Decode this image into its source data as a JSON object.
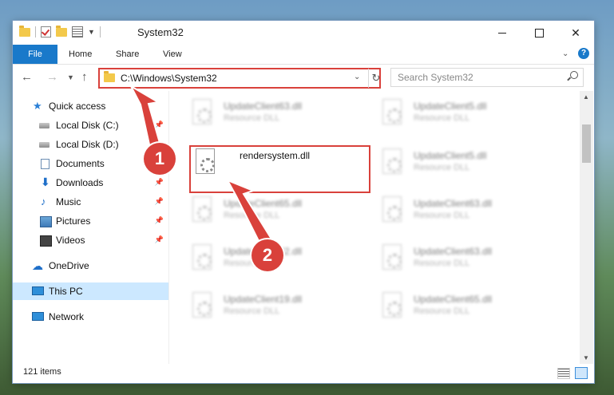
{
  "window": {
    "title": "System32",
    "controls": {
      "minimize": "",
      "maximize": "",
      "close": "✕"
    }
  },
  "ribbon": {
    "tabs": [
      {
        "label": "File"
      },
      {
        "label": "Home"
      },
      {
        "label": "Share"
      },
      {
        "label": "View"
      }
    ],
    "help": "?"
  },
  "navigation": {
    "address": "C:\\Windows\\System32",
    "search_placeholder": "Search System32"
  },
  "sidebar": {
    "items": [
      {
        "label": "Quick access",
        "icon": "star-icon",
        "pinned": false
      },
      {
        "label": "Local Disk (C:)",
        "icon": "disk-icon",
        "pinned": true
      },
      {
        "label": "Local Disk (D:)",
        "icon": "disk-icon",
        "pinned": false
      },
      {
        "label": "Documents",
        "icon": "document-icon",
        "pinned": true
      },
      {
        "label": "Downloads",
        "icon": "download-icon",
        "pinned": true
      },
      {
        "label": "Music",
        "icon": "music-icon",
        "pinned": true
      },
      {
        "label": "Pictures",
        "icon": "pictures-icon",
        "pinned": true
      },
      {
        "label": "Videos",
        "icon": "videos-icon",
        "pinned": true
      },
      {
        "label": "OneDrive",
        "icon": "cloud-icon",
        "pinned": false
      },
      {
        "label": "This PC",
        "icon": "computer-icon",
        "pinned": false,
        "selected": true
      },
      {
        "label": "Network",
        "icon": "network-icon",
        "pinned": false
      }
    ]
  },
  "files": [
    {
      "name": "UpdateClient63.dll",
      "type": "Resource DLL",
      "blurred": true
    },
    {
      "name": "UpdateClient5.dll",
      "type": "Resource DLL",
      "blurred": true
    },
    {
      "name": "rendersystem.dll",
      "type": "",
      "blurred": false
    },
    {
      "name": "UpdateClient5.dll",
      "type": "Resource DLL",
      "blurred": true
    },
    {
      "name": "UpdateClient65.dll",
      "type": "Resource DLL",
      "blurred": true
    },
    {
      "name": "UpdateClient63.dll",
      "type": "Resource DLL",
      "blurred": true
    },
    {
      "name": "UpdateClient42.dll",
      "type": "Resource DLL",
      "blurred": true
    },
    {
      "name": "UpdateClient63.dll",
      "type": "Resource DLL",
      "blurred": true
    },
    {
      "name": "UpdateClient19.dll",
      "type": "Resource DLL",
      "blurred": true
    },
    {
      "name": "UpdateClient65.dll",
      "type": "Resource DLL",
      "blurred": true
    }
  ],
  "status": {
    "item_count": "121 items"
  },
  "annotations": {
    "step1": "1",
    "step2": "2",
    "color": "#d9413b"
  }
}
